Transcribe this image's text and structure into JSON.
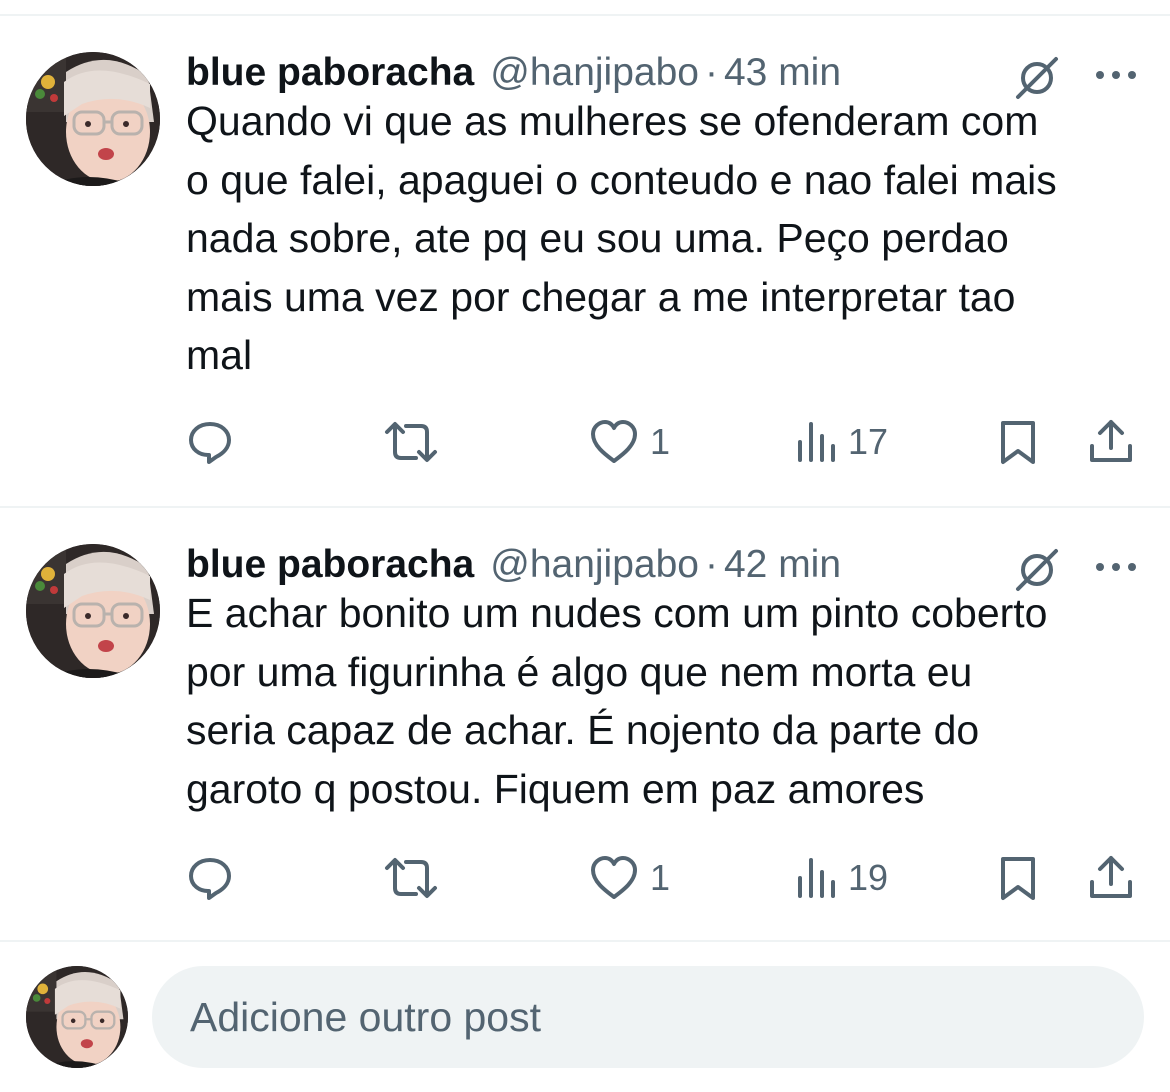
{
  "posts": [
    {
      "author_name": "blue paboracha",
      "handle": "@hanjipabo",
      "separator": "·",
      "time": "43 min",
      "text": "Quando vi que as mulheres se ofenderam com\no que falei, apaguei o conteudo e nao falei mais\nnada sobre, ate pq eu sou uma. Peço perdao\nmais uma vez por chegar a me interpretar tao\nmal",
      "actions": {
        "reply_icon": "reply-icon",
        "retweet_icon": "retweet-icon",
        "like_icon": "heart-icon",
        "like_count": "1",
        "views_icon": "views-icon",
        "views_count": "17",
        "bookmark_icon": "bookmark-icon",
        "share_icon": "share-icon"
      }
    },
    {
      "author_name": "blue paboracha",
      "handle": "@hanjipabo",
      "separator": "·",
      "time": "42 min",
      "text": "E achar bonito um nudes com um pinto coberto\npor uma figurinha é algo que nem morta eu\nseria capaz de achar. É nojento da parte do\ngaroto q postou. Fiquem em paz amores",
      "actions": {
        "reply_icon": "reply-icon",
        "retweet_icon": "retweet-icon",
        "like_icon": "heart-icon",
        "like_count": "1",
        "views_icon": "views-icon",
        "views_count": "19",
        "bookmark_icon": "bookmark-icon",
        "share_icon": "share-icon"
      }
    }
  ],
  "compose": {
    "placeholder": "Adicione outro post"
  },
  "colors": {
    "text_primary": "#0f1419",
    "text_secondary": "#536471",
    "divider": "#eff3f4",
    "compose_bg": "#eff3f4"
  }
}
